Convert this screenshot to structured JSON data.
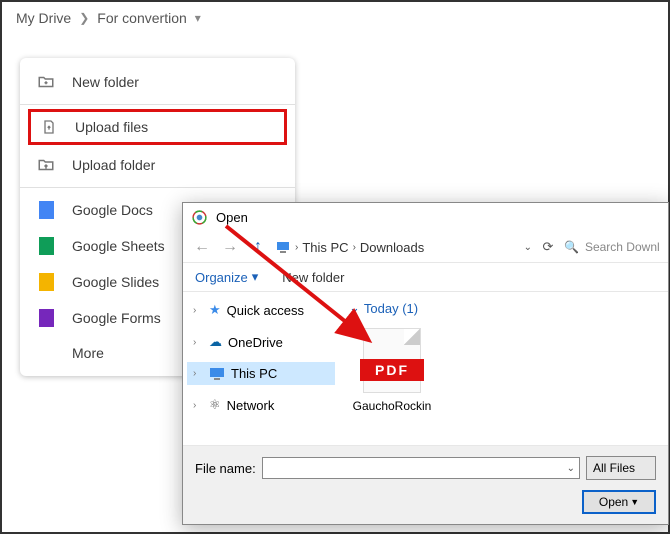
{
  "breadcrumb": {
    "root": "My Drive",
    "folder": "For convertion"
  },
  "menu": {
    "new_folder": "New folder",
    "upload_files": "Upload files",
    "upload_folder": "Upload folder",
    "google_docs": "Google Docs",
    "google_sheets": "Google Sheets",
    "google_slides": "Google Slides",
    "google_forms": "Google Forms",
    "more": "More"
  },
  "dialog": {
    "title": "Open",
    "path_root": "This PC",
    "path_folder": "Downloads",
    "search_placeholder": "Search Downloads",
    "organize": "Organize",
    "new_folder": "New folder",
    "tree": {
      "quick": "Quick access",
      "onedrive": "OneDrive",
      "thispc": "This PC",
      "network": "Network"
    },
    "group_header": "Today (1)",
    "file_name": "GauchoRockin",
    "file_badge": "PDF",
    "fn_label": "File name:",
    "filter": "All Files",
    "open_btn": "Open",
    "dd_arrow": "▾"
  }
}
